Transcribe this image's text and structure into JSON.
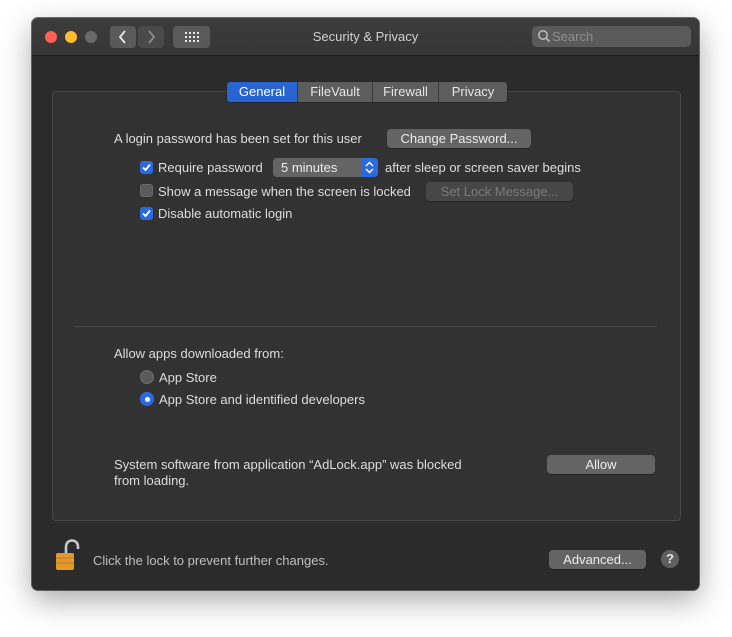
{
  "window": {
    "title": "Security & Privacy"
  },
  "search": {
    "placeholder": "Search",
    "value": ""
  },
  "tabs": [
    {
      "label": "General",
      "active": true
    },
    {
      "label": "FileVault",
      "active": false
    },
    {
      "label": "Firewall",
      "active": false
    },
    {
      "label": "Privacy",
      "active": false
    }
  ],
  "general": {
    "login_password_text": "A login password has been set for this user",
    "change_password_label": "Change Password...",
    "require_password": {
      "label": "Require password",
      "checked": true,
      "selected_option": "5 minutes",
      "suffix": "after sleep or screen saver begins"
    },
    "show_message": {
      "label": "Show a message when the screen is locked",
      "checked": false,
      "button_label": "Set Lock Message..."
    },
    "disable_auto_login": {
      "label": "Disable automatic login",
      "checked": true
    }
  },
  "allow_apps": {
    "heading": "Allow apps downloaded from:",
    "options": [
      {
        "label": "App Store",
        "selected": false
      },
      {
        "label": "App Store and identified developers",
        "selected": true
      }
    ]
  },
  "blocked": {
    "line1": "System software from application “AdLock.app” was blocked",
    "line2": "from loading.",
    "allow_label": "Allow"
  },
  "footer": {
    "lock_text": "Click the lock to prevent further changes.",
    "advanced_label": "Advanced...",
    "help_label": "?"
  },
  "colors": {
    "accent": "#2864d2",
    "lock": "#e8a030"
  }
}
